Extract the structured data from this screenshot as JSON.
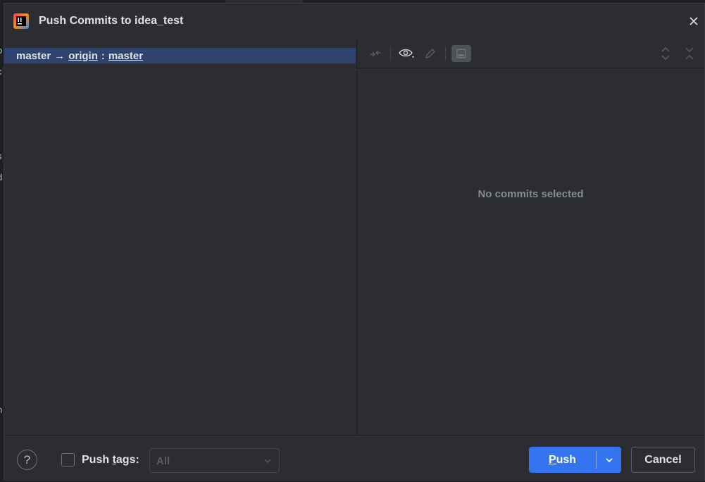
{
  "background_ide": {
    "edge_chars": [
      ".",
      "o",
      "c",
      "s",
      "d",
      "n"
    ]
  },
  "dialog": {
    "title": "Push Commits to idea_test",
    "app_icon": "intellij-idea-icon",
    "close_icon": "close-icon"
  },
  "branch": {
    "local": "master",
    "arrow": "→",
    "remote": "origin",
    "separator": ":",
    "remote_branch": "master"
  },
  "toolbar": {
    "icons": [
      "collapse-arrows-icon",
      "eye-icon",
      "edit-pencil-icon",
      "preview-panel-icon",
      "expand-all-icon",
      "collapse-all-icon"
    ]
  },
  "details": {
    "empty_text": "No commits selected"
  },
  "footer": {
    "help_label": "?",
    "push_tags_label_pre": "Push ",
    "push_tags_label_mn": "t",
    "push_tags_label_post": "ags:",
    "push_tags_checked": false,
    "tags_select_value": "All",
    "push_label_mn": "P",
    "push_label_rest": "ush",
    "cancel_label": "Cancel"
  },
  "colors": {
    "accent": "#3574f0",
    "selection": "#2e436e",
    "panel": "#2b2d30",
    "muted_text": "#868a91"
  }
}
